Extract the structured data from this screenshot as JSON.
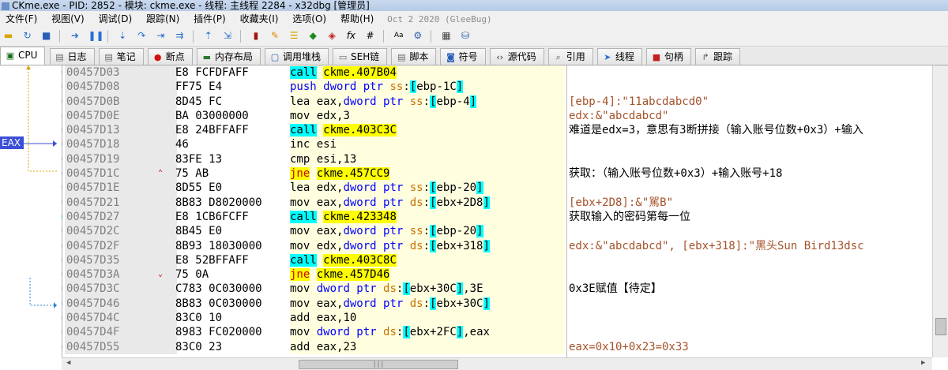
{
  "window": {
    "title": "CKme.exe - PID: 2852 - 模块: ckme.exe - 线程: 主线程 2284 - x32dbg [管理员]"
  },
  "menu": {
    "items": [
      "文件(F)",
      "视图(V)",
      "调试(D)",
      "跟踪(N)",
      "插件(P)",
      "收藏夹(I)",
      "选项(O)",
      "帮助(H)"
    ],
    "date": "Oct 2 2020 (GleeBug)"
  },
  "tabs": [
    {
      "label": "CPU",
      "icon": "cpu-icon"
    },
    {
      "label": "日志",
      "icon": "log-icon"
    },
    {
      "label": "笔记",
      "icon": "notes-icon"
    },
    {
      "label": "断点",
      "icon": "breakpoint-icon"
    },
    {
      "label": "内存布局",
      "icon": "memory-icon"
    },
    {
      "label": "调用堆栈",
      "icon": "callstack-icon"
    },
    {
      "label": "SEH链",
      "icon": "seh-icon"
    },
    {
      "label": "脚本",
      "icon": "script-icon"
    },
    {
      "label": "符号",
      "icon": "symbol-icon"
    },
    {
      "label": "源代码",
      "icon": "source-icon"
    },
    {
      "label": "引用",
      "icon": "reference-icon"
    },
    {
      "label": "线程",
      "icon": "thread-icon"
    },
    {
      "label": "句柄",
      "icon": "handle-icon"
    },
    {
      "label": "跟踪",
      "icon": "trace-icon"
    }
  ],
  "gutter": {
    "eax_label": "EAX"
  },
  "rows": [
    {
      "addr": "00457D03",
      "bytes": "E8 FCFDFAFF",
      "mn": "call",
      "ops": "ckme.407B04",
      "comment": "",
      "bp": "grey",
      "arrow": ""
    },
    {
      "addr": "00457D08",
      "bytes": "FF75 E4",
      "mn": "push",
      "ops": "dword ptr ss:[ebp-1C]",
      "comment": "",
      "bp": "grey",
      "arrow": ""
    },
    {
      "addr": "00457D0B",
      "bytes": "8D45 FC",
      "mn": "lea",
      "ops": "eax,dword ptr ss:[ebp-4]",
      "comment": "[ebp-4]:\"11abcdabcd0\"",
      "bp": "grey",
      "arrow": ""
    },
    {
      "addr": "00457D0E",
      "bytes": "BA 03000000",
      "mn": "mov",
      "ops": "edx,3",
      "comment": "edx:&\"abcdabcd\"",
      "bp": "grey",
      "arrow": ""
    },
    {
      "addr": "00457D13",
      "bytes": "E8 24BFFAFF",
      "mn": "call",
      "ops": "ckme.403C3C",
      "comment": "难道是edx=3，意思有3断拼接（输入账号位数+0x3）+输入",
      "bp": "grey",
      "arrow": ""
    },
    {
      "addr": "00457D18",
      "bytes": "46",
      "mn": "inc",
      "ops": "esi",
      "comment": "",
      "bp": "grey",
      "arrow": ""
    },
    {
      "addr": "00457D19",
      "bytes": "83FE 13",
      "mn": "cmp",
      "ops": "esi,13",
      "comment": "",
      "bp": "grey",
      "arrow": ""
    },
    {
      "addr": "00457D1C",
      "bytes": "75 AB",
      "mn": "jne",
      "ops": "ckme.457CC9",
      "comment": "获取：（输入账号位数+0x3）+输入账号+18",
      "bp": "grey",
      "arrow": "^"
    },
    {
      "addr": "00457D1E",
      "bytes": "8D55 E0",
      "mn": "lea",
      "ops": "edx,dword ptr ss:[ebp-20]",
      "comment": "",
      "bp": "grey",
      "arrow": ""
    },
    {
      "addr": "00457D21",
      "bytes": "8B83 D8020000",
      "mn": "mov",
      "ops": "eax,dword ptr ds:[ebx+2D8]",
      "comment": "[ebx+2D8]:&\"駡B\"",
      "bp": "grey",
      "arrow": ""
    },
    {
      "addr": "00457D27",
      "bytes": "E8 1CB6FCFF",
      "mn": "call",
      "ops": "ckme.423348",
      "comment": "获取输入的密码第每一位",
      "bp": "green",
      "arrow": ""
    },
    {
      "addr": "00457D2C",
      "bytes": "8B45 E0",
      "mn": "mov",
      "ops": "eax,dword ptr ss:[ebp-20]",
      "comment": "",
      "bp": "grey",
      "arrow": ""
    },
    {
      "addr": "00457D2F",
      "bytes": "8B93 18030000",
      "mn": "mov",
      "ops": "edx,dword ptr ds:[ebx+318]",
      "comment": "edx:&\"abcdabcd\", [ebx+318]:\"黑头Sun Bird13dsc",
      "bp": "grey",
      "arrow": ""
    },
    {
      "addr": "00457D35",
      "bytes": "E8 52BFFAFF",
      "mn": "call",
      "ops": "ckme.403C8C",
      "comment": "",
      "bp": "grey",
      "arrow": ""
    },
    {
      "addr": "00457D3A",
      "bytes": "75 0A",
      "mn": "jne",
      "ops": "ckme.457D46",
      "comment": "",
      "bp": "grey",
      "arrow": "v"
    },
    {
      "addr": "00457D3C",
      "bytes": "C783 0C030000",
      "mn": "mov",
      "ops": "dword ptr ds:[ebx+30C],3E",
      "comment": "0x3E赋值【待定】",
      "bp": "grey",
      "arrow": ""
    },
    {
      "addr": "00457D46",
      "bytes": "8B83 0C030000",
      "mn": "mov",
      "ops": "eax,dword ptr ds:[ebx+30C]",
      "comment": "",
      "bp": "grey",
      "arrow": ""
    },
    {
      "addr": "00457D4C",
      "bytes": "83C0 10",
      "mn": "add",
      "ops": "eax,10",
      "comment": "",
      "bp": "grey",
      "arrow": ""
    },
    {
      "addr": "00457D4F",
      "bytes": "8983 FC020000",
      "mn": "mov",
      "ops": "dword ptr ds:[ebx+2FC],eax",
      "comment": "",
      "bp": "grey",
      "arrow": ""
    },
    {
      "addr": "00457D55",
      "bytes": "83C0 23",
      "mn": "add",
      "ops": "eax,23",
      "comment": "eax=0x10+0x23=0x33",
      "bp": "grey",
      "arrow": ""
    }
  ]
}
